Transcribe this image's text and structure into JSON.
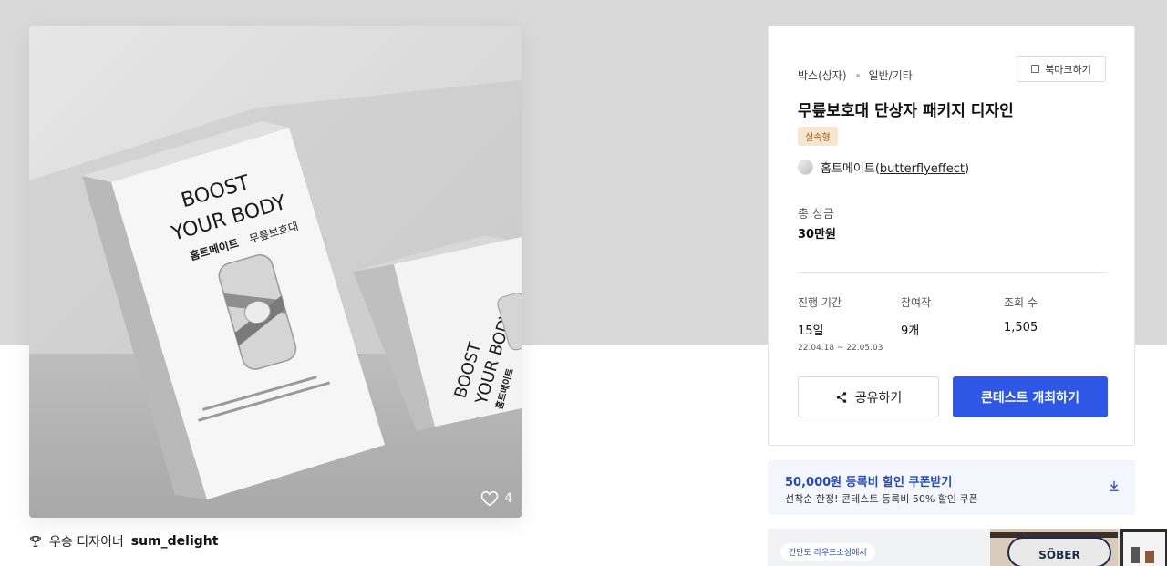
{
  "photo": {
    "box_front_title_line1": "BOOST",
    "box_front_title_line2": "YOUR BODY",
    "box_front_subtitle_bold": "홈트메이트",
    "box_front_subtitle": "무릎보호대",
    "like_count": "4"
  },
  "winner": {
    "label": "우승 디자이너",
    "name": "sum_delight"
  },
  "card": {
    "category": "박스(상자)",
    "subcategory": "일반/기타",
    "bookmark_label": "북마크하기",
    "title": "무릎보호대 단상자 패키지 디자인",
    "tag": "실속형",
    "host_name": "홈트메이트",
    "host_id": "butterflyeffect",
    "prize_label": "총 상금",
    "prize_value": "30만원",
    "stats": {
      "period_label": "진행 기간",
      "period_value": "15일",
      "period_dates": "22.04.18 ~ 22.05.03",
      "entries_label": "참여작",
      "entries_value": "9개",
      "views_label": "조회 수",
      "views_value": "1,505"
    },
    "share_label": "공유하기",
    "host_contest_label": "콘테스트 개최하기"
  },
  "coupon": {
    "title": "50,000원 등록비 할인 쿠폰받기",
    "subtitle": "선착순 한정! 콘테스트 등록비 50% 할인 쿠폰"
  },
  "banner": {
    "pill": "간만도 라우드소싱에서",
    "sign_text": "SÖBER"
  },
  "colors": {
    "primary_button": "#2e57e6",
    "coupon_title": "#2747b8",
    "tag_bg": "#f7e5cf",
    "tag_text": "#9a5a1e"
  }
}
